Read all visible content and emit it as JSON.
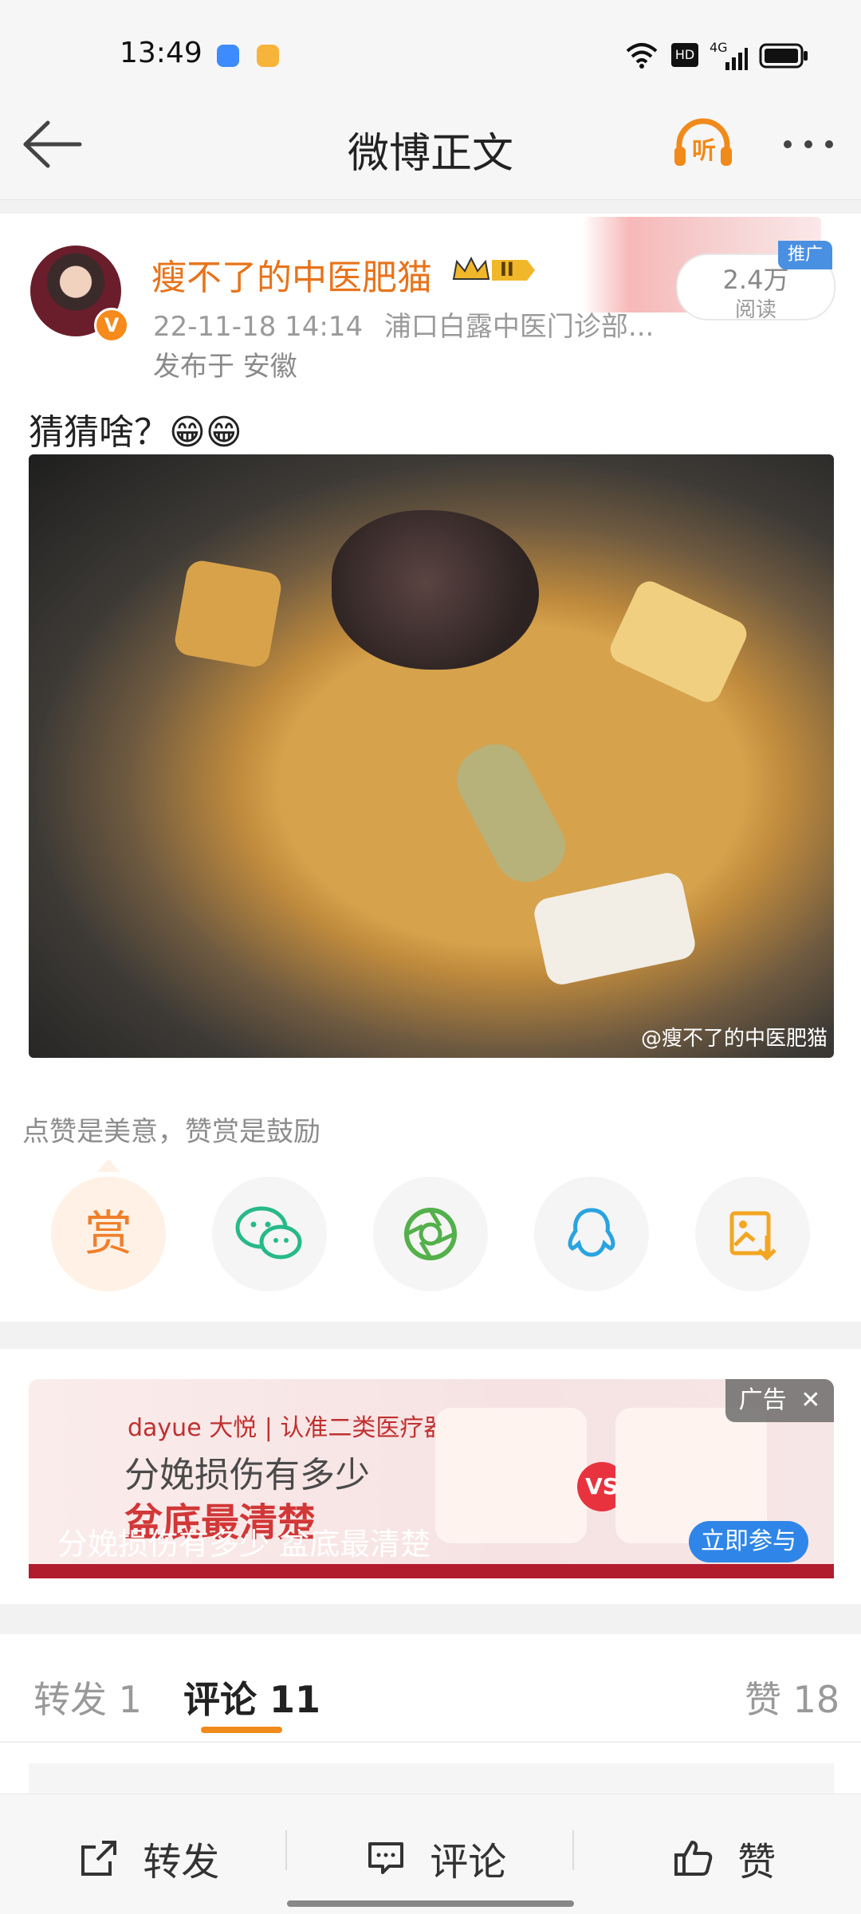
{
  "status_bar": {
    "time": "13:49",
    "hd": "HD",
    "network": "4G"
  },
  "nav": {
    "title": "微博正文",
    "listen_label": "听"
  },
  "post": {
    "author": "瘦不了的中医肥猫",
    "vip_level": "II",
    "datetime": "22-11-18 14:14",
    "source": "浦口白露中医门诊部...",
    "location": "发布于 安徽",
    "reads_count": "2.4万",
    "reads_label": "阅读",
    "promo_tag": "推广",
    "text": "猜猜啥？😁😁",
    "watermark": "@瘦不了的中医肥猫",
    "reward_tip": "点赞是美意，赞赏是鼓励",
    "reward_label": "赏"
  },
  "share_buttons": [
    "reward-icon",
    "wechat-icon",
    "moments-icon",
    "qq-icon",
    "save-image-icon"
  ],
  "ad": {
    "brand": "dayue 大悦 | 认准二类医疗器械",
    "line1": "分娩损伤有多少",
    "line2": "盆底最清楚",
    "caption": "分娩损伤有多少 盆底最清楚",
    "cta": "立即参与",
    "tag": "广告",
    "vs": "VS"
  },
  "tabs": {
    "repost": "转发 1",
    "comment": "评论 11",
    "like": "赞 18"
  },
  "bottom_bar": {
    "repost": "转发",
    "comment": "评论",
    "like": "赞"
  },
  "colors": {
    "accent": "#f08a1b",
    "username": "#e8731b",
    "link_blue": "#2f86e8"
  }
}
